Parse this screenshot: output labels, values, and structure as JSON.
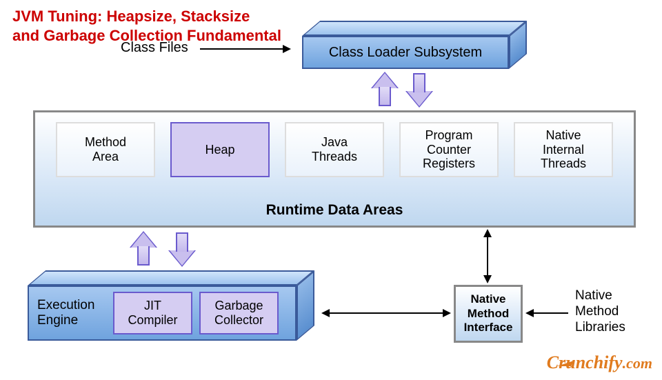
{
  "title_line1": "JVM Tuning: Heapsize, Stacksize",
  "title_line2": "and Garbage Collection Fundamental",
  "labels": {
    "class_files": "Class Files",
    "native_libs_l1": "Native",
    "native_libs_l2": "Method",
    "native_libs_l3": "Libraries"
  },
  "class_loader": {
    "label": "Class Loader Subsystem"
  },
  "rda": {
    "title": "Runtime Data Areas",
    "boxes": [
      {
        "label": "Method\nArea",
        "variant": "plain"
      },
      {
        "label": "Heap",
        "variant": "heap"
      },
      {
        "label": "Java\nThreads",
        "variant": "plain"
      },
      {
        "label": "Program\nCounter\nRegisters",
        "variant": "plain"
      },
      {
        "label": "Native\nInternal\nThreads",
        "variant": "plain"
      }
    ]
  },
  "exec": {
    "label": "Execution\nEngine",
    "jit": "JIT\nCompiler",
    "gc": "Garbage\nCollector"
  },
  "nmi": "Native\nMethod\nInterface",
  "brand": {
    "name": "Crunchify",
    "suffix": ".com"
  }
}
